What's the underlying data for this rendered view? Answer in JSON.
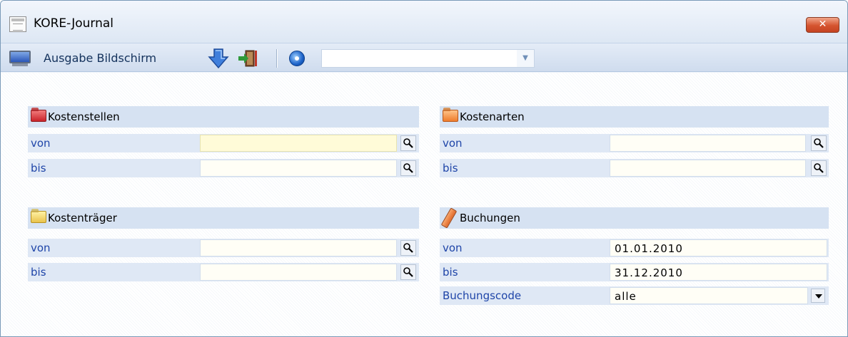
{
  "window": {
    "title": "KORE-Journal",
    "close_label": "✕"
  },
  "toolbar": {
    "output_label": "Ausgabe Bildschirm",
    "combo_value": ""
  },
  "kostenstellen": {
    "title": "Kostenstellen",
    "von_label": "von",
    "von_value": "",
    "bis_label": "bis",
    "bis_value": ""
  },
  "kostenarten": {
    "title": "Kostenarten",
    "von_label": "von",
    "von_value": "",
    "bis_label": "bis",
    "bis_value": ""
  },
  "kostentraeger": {
    "title": "Kostenträger",
    "von_label": "von",
    "von_value": "",
    "bis_label": "bis",
    "bis_value": ""
  },
  "buchungen": {
    "title": "Buchungen",
    "von_label": "von",
    "von_value": "01.01.2010",
    "bis_label": "bis",
    "bis_value": "31.12.2010",
    "code_label": "Buchungscode",
    "code_value": "alle"
  },
  "icons": {
    "title": "window-icon",
    "monitor": "monitor-icon",
    "download": "download-arrow-icon",
    "exit": "exit-door-icon",
    "disc": "disc-icon",
    "lookup": "magnifier-icon",
    "folder_red": "folder-red-icon",
    "folder_orange": "folder-orange-icon",
    "folder_yellow": "folder-yellow-icon",
    "pencil": "pencil-icon"
  },
  "colors": {
    "label_blue": "#1f45a8",
    "close_red": "#d5542f",
    "section_bg": "#d6e2f2",
    "row_bg": "#dfe8f5",
    "field_bg": "#fffbe6"
  }
}
